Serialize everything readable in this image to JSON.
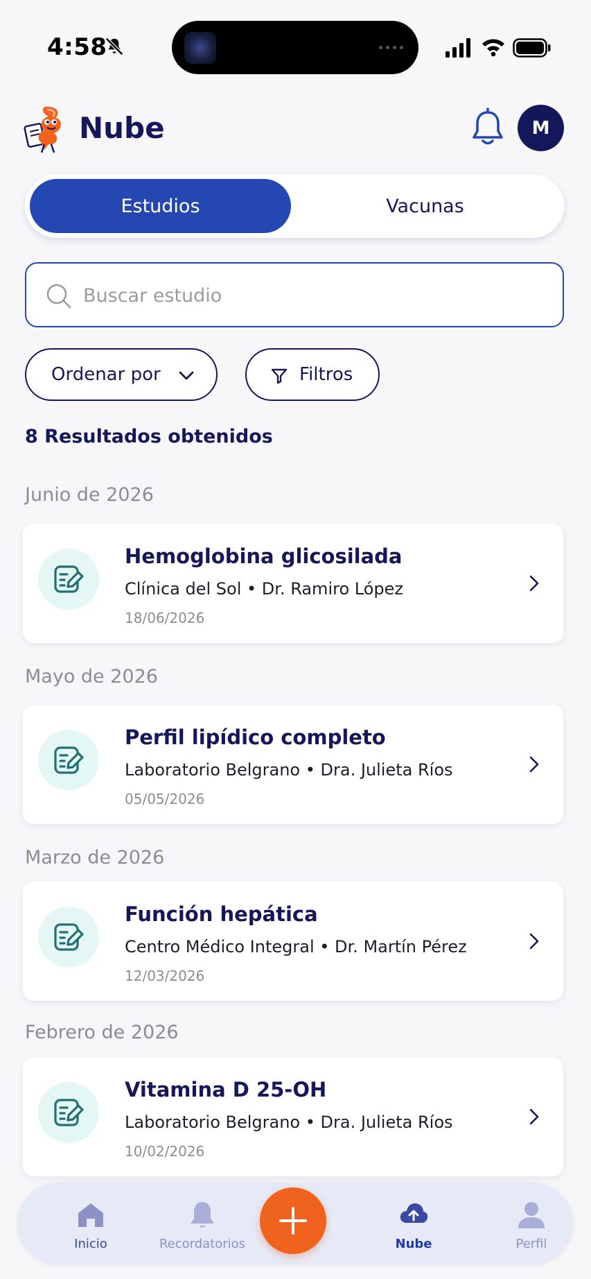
{
  "status": {
    "time": "4:58"
  },
  "header": {
    "title": "Nube",
    "avatar_initial": "M"
  },
  "tabs": [
    {
      "label": "Estudios",
      "active": true
    },
    {
      "label": "Vacunas",
      "active": false
    }
  ],
  "search": {
    "placeholder": "Buscar estudio",
    "value": ""
  },
  "controls": {
    "sort_label": "Ordenar por",
    "filter_label": "Filtros"
  },
  "results_text": "8 Resultados obtenidos",
  "groups": [
    {
      "month": "Junio de 2026",
      "item": {
        "title": "Hemoglobina glicosilada",
        "subtitle": "Clínica del Sol • Dr. Ramiro López",
        "date": "18/06/2026"
      }
    },
    {
      "month": "Mayo de 2026",
      "item": {
        "title": "Perfil lipídico completo",
        "subtitle": "Laboratorio Belgrano • Dra. Julieta Ríos",
        "date": "05/05/2026"
      }
    },
    {
      "month": "Marzo de 2026",
      "item": {
        "title": "Función hepática",
        "subtitle": "Centro Médico Integral • Dr. Martín Pérez",
        "date": "12/03/2026"
      }
    },
    {
      "month": "Febrero de 2026",
      "item": {
        "title": "Vitamina D 25-OH",
        "subtitle": "Laboratorio Belgrano • Dra. Julieta Ríos",
        "date": "10/02/2026"
      }
    }
  ],
  "bottom_nav": {
    "items": [
      {
        "label": "Inicio",
        "icon": "home-icon"
      },
      {
        "label": "Recordatorios",
        "icon": "bell-icon"
      },
      {
        "label": "Nube",
        "icon": "cloud-upload-icon",
        "active": true
      },
      {
        "label": "Perfil",
        "icon": "person-icon"
      }
    ],
    "fab_icon": "plus-icon"
  },
  "colors": {
    "primary": "#2547b1",
    "navy": "#14185a",
    "accent_orange": "#f0631e",
    "icon_bg": "#e4f7f5",
    "icon_teal": "#1f6f73"
  }
}
